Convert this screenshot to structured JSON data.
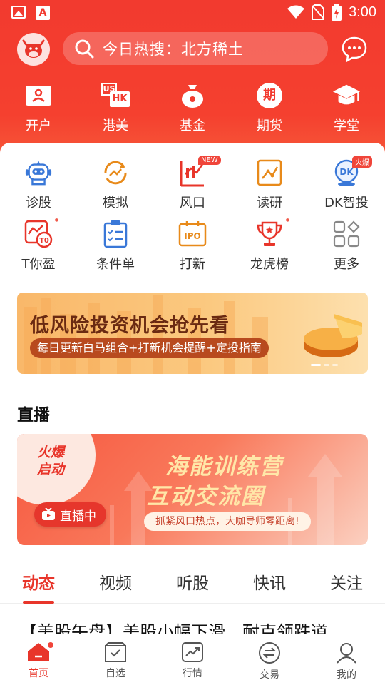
{
  "status_bar": {
    "time": "3:00",
    "app_icon_letter": "A"
  },
  "search": {
    "text": "今日热搜：北方稀土"
  },
  "top_nav": [
    {
      "label": "开户",
      "icon": "id-card-icon"
    },
    {
      "label": "港美",
      "icon": "us-hk-icon",
      "icon_text_1": "US",
      "icon_text_2": "HK"
    },
    {
      "label": "基金",
      "icon": "money-bag-icon"
    },
    {
      "label": "期货",
      "icon": "futures-icon",
      "icon_text": "期"
    },
    {
      "label": "学堂",
      "icon": "graduation-cap-icon"
    }
  ],
  "grid": {
    "row1": [
      {
        "label": "诊股",
        "icon": "robot-icon"
      },
      {
        "label": "模拟",
        "icon": "simulate-icon"
      },
      {
        "label": "风口",
        "icon": "trend-chart-icon",
        "badge": "NEW"
      },
      {
        "label": "读研",
        "icon": "research-book-icon"
      },
      {
        "label": "DK智投",
        "icon": "dk-globe-icon",
        "badge": "火爆",
        "icon_text": "DK"
      }
    ],
    "row2": [
      {
        "label": "T你盈",
        "icon": "t0-chart-icon",
        "icon_text": "T0"
      },
      {
        "label": "条件单",
        "icon": "checklist-icon"
      },
      {
        "label": "打新",
        "icon": "ipo-icon",
        "icon_text": "IPO"
      },
      {
        "label": "龙虎榜",
        "icon": "trophy-icon"
      },
      {
        "label": "更多",
        "icon": "more-grid-icon"
      }
    ]
  },
  "banner1": {
    "title": "低风险投资机会抢先看",
    "subtitle": "每日更新白马组合+打新机会提醒+定投指南"
  },
  "live_section": {
    "title": "直播",
    "corner_text": "火爆启动",
    "headline_1": "海能训练营",
    "headline_2": "互动交流圈",
    "subtitle": "抓紧风口热点，大咖导师零距离!",
    "live_button": "直播中"
  },
  "tabs": [
    "动态",
    "视频",
    "听股",
    "快讯",
    "关注"
  ],
  "news_peek": "【美股午盘】美股小幅下滑，耐克领跌道",
  "bottom_nav": [
    {
      "label": "首页",
      "icon": "home-icon"
    },
    {
      "label": "自选",
      "icon": "watchlist-icon"
    },
    {
      "label": "行情",
      "icon": "market-chart-icon"
    },
    {
      "label": "交易",
      "icon": "trade-exchange-icon"
    },
    {
      "label": "我的",
      "icon": "profile-icon"
    }
  ],
  "colors": {
    "brand_red": "#f23a2f",
    "accent_red": "#e8352a",
    "icon_blue": "#3a78d8",
    "icon_orange": "#e88a1a"
  }
}
